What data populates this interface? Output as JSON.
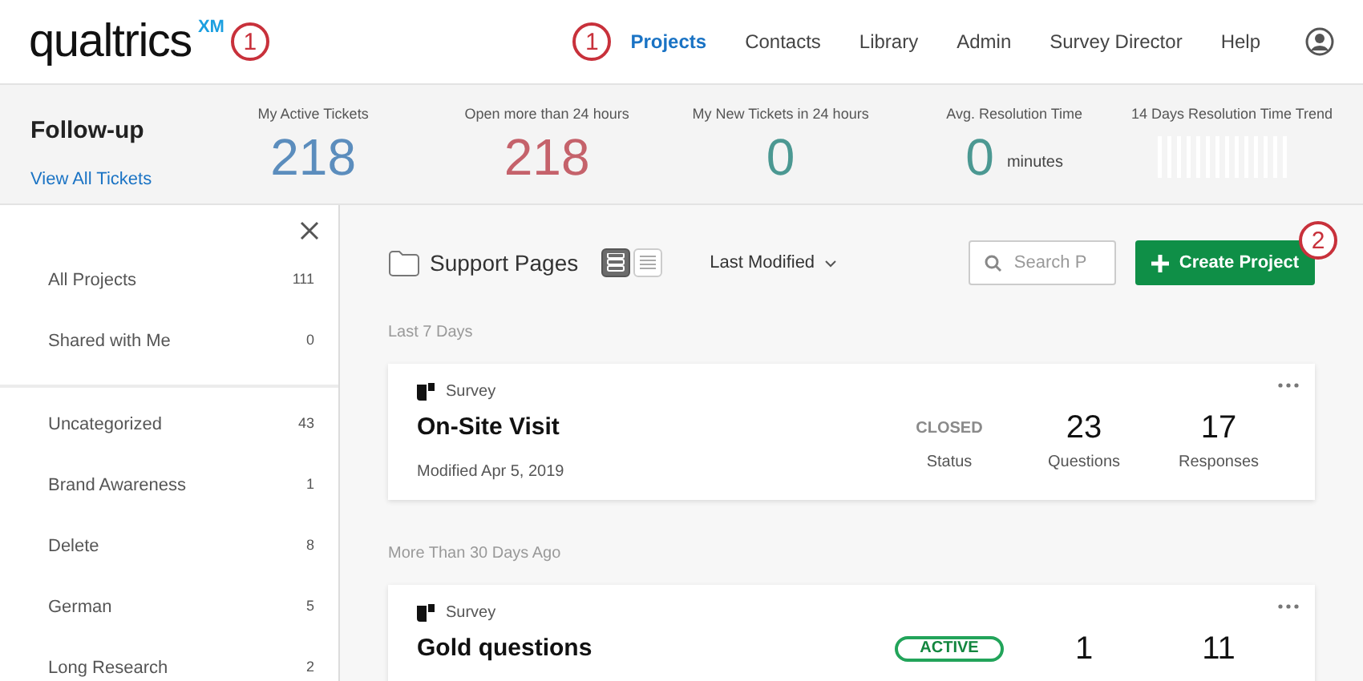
{
  "logo": {
    "text": "qualtrics",
    "superscript": "XM",
    "callout": "1"
  },
  "nav_callout": "1",
  "nav": [
    {
      "label": "Projects",
      "selected": true
    },
    {
      "label": "Contacts",
      "selected": false
    },
    {
      "label": "Library",
      "selected": false
    },
    {
      "label": "Admin",
      "selected": false
    },
    {
      "label": "Survey Director",
      "selected": false
    },
    {
      "label": "Help",
      "selected": false
    }
  ],
  "followup": {
    "title": "Follow-up",
    "link": "View All Tickets"
  },
  "stats": [
    {
      "label": "My Active Tickets",
      "value": "218",
      "color": "#5b8dbd"
    },
    {
      "label": "Open more than 24 hours",
      "value": "218",
      "color": "#c5626b"
    },
    {
      "label": "My New Tickets in 24 hours",
      "value": "0",
      "color": "#4b9892"
    },
    {
      "label": "Avg. Resolution Time",
      "value": "0",
      "unit": "minutes",
      "color": "#4b9892"
    }
  ],
  "trend": {
    "label": "14 Days Resolution Time Trend"
  },
  "sidebar": {
    "groups": [
      [
        {
          "label": "All Projects",
          "count": "111"
        },
        {
          "label": "Shared with Me",
          "count": "0"
        }
      ],
      [
        {
          "label": "Uncategorized",
          "count": "43"
        },
        {
          "label": "Brand Awareness",
          "count": "1"
        },
        {
          "label": "Delete",
          "count": "8"
        },
        {
          "label": "German",
          "count": "5"
        },
        {
          "label": "Long Research",
          "count": "2"
        }
      ]
    ]
  },
  "toolbar": {
    "folder": "Support Pages",
    "views": [
      {
        "kind": "cards",
        "selected": true
      },
      {
        "kind": "list",
        "selected": false
      }
    ],
    "sort": "Last Modified",
    "search_placeholder": "Search P",
    "create": "Create Project",
    "create_callout": "2"
  },
  "sections": [
    {
      "heading": "Last 7 Days",
      "projects": [
        {
          "type": "Survey",
          "name": "On-Site Visit",
          "modified": "Modified Apr 5, 2019",
          "status": {
            "kind": "closed",
            "text": "CLOSED"
          },
          "questions": "23",
          "responses": "17",
          "labels": [
            "Status",
            "Questions",
            "Responses"
          ]
        }
      ]
    },
    {
      "heading": "More Than 30 Days Ago",
      "projects": [
        {
          "type": "Survey",
          "name": "Gold questions",
          "status": {
            "kind": "active",
            "text": "ACTIVE"
          },
          "questions": "1",
          "responses": "11"
        }
      ]
    }
  ]
}
